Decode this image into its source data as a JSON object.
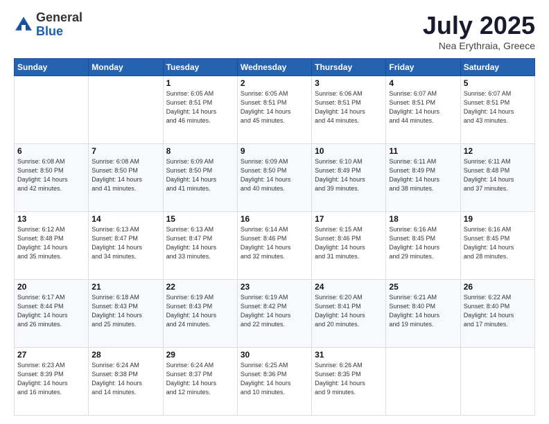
{
  "header": {
    "logo_general": "General",
    "logo_blue": "Blue",
    "month": "July 2025",
    "location": "Nea Erythraia, Greece"
  },
  "weekdays": [
    "Sunday",
    "Monday",
    "Tuesday",
    "Wednesday",
    "Thursday",
    "Friday",
    "Saturday"
  ],
  "weeks": [
    [
      {
        "day": "",
        "info": ""
      },
      {
        "day": "",
        "info": ""
      },
      {
        "day": "1",
        "info": "Sunrise: 6:05 AM\nSunset: 8:51 PM\nDaylight: 14 hours\nand 46 minutes."
      },
      {
        "day": "2",
        "info": "Sunrise: 6:05 AM\nSunset: 8:51 PM\nDaylight: 14 hours\nand 45 minutes."
      },
      {
        "day": "3",
        "info": "Sunrise: 6:06 AM\nSunset: 8:51 PM\nDaylight: 14 hours\nand 44 minutes."
      },
      {
        "day": "4",
        "info": "Sunrise: 6:07 AM\nSunset: 8:51 PM\nDaylight: 14 hours\nand 44 minutes."
      },
      {
        "day": "5",
        "info": "Sunrise: 6:07 AM\nSunset: 8:51 PM\nDaylight: 14 hours\nand 43 minutes."
      }
    ],
    [
      {
        "day": "6",
        "info": "Sunrise: 6:08 AM\nSunset: 8:50 PM\nDaylight: 14 hours\nand 42 minutes."
      },
      {
        "day": "7",
        "info": "Sunrise: 6:08 AM\nSunset: 8:50 PM\nDaylight: 14 hours\nand 41 minutes."
      },
      {
        "day": "8",
        "info": "Sunrise: 6:09 AM\nSunset: 8:50 PM\nDaylight: 14 hours\nand 41 minutes."
      },
      {
        "day": "9",
        "info": "Sunrise: 6:09 AM\nSunset: 8:50 PM\nDaylight: 14 hours\nand 40 minutes."
      },
      {
        "day": "10",
        "info": "Sunrise: 6:10 AM\nSunset: 8:49 PM\nDaylight: 14 hours\nand 39 minutes."
      },
      {
        "day": "11",
        "info": "Sunrise: 6:11 AM\nSunset: 8:49 PM\nDaylight: 14 hours\nand 38 minutes."
      },
      {
        "day": "12",
        "info": "Sunrise: 6:11 AM\nSunset: 8:48 PM\nDaylight: 14 hours\nand 37 minutes."
      }
    ],
    [
      {
        "day": "13",
        "info": "Sunrise: 6:12 AM\nSunset: 8:48 PM\nDaylight: 14 hours\nand 35 minutes."
      },
      {
        "day": "14",
        "info": "Sunrise: 6:13 AM\nSunset: 8:47 PM\nDaylight: 14 hours\nand 34 minutes."
      },
      {
        "day": "15",
        "info": "Sunrise: 6:13 AM\nSunset: 8:47 PM\nDaylight: 14 hours\nand 33 minutes."
      },
      {
        "day": "16",
        "info": "Sunrise: 6:14 AM\nSunset: 8:46 PM\nDaylight: 14 hours\nand 32 minutes."
      },
      {
        "day": "17",
        "info": "Sunrise: 6:15 AM\nSunset: 8:46 PM\nDaylight: 14 hours\nand 31 minutes."
      },
      {
        "day": "18",
        "info": "Sunrise: 6:16 AM\nSunset: 8:45 PM\nDaylight: 14 hours\nand 29 minutes."
      },
      {
        "day": "19",
        "info": "Sunrise: 6:16 AM\nSunset: 8:45 PM\nDaylight: 14 hours\nand 28 minutes."
      }
    ],
    [
      {
        "day": "20",
        "info": "Sunrise: 6:17 AM\nSunset: 8:44 PM\nDaylight: 14 hours\nand 26 minutes."
      },
      {
        "day": "21",
        "info": "Sunrise: 6:18 AM\nSunset: 8:43 PM\nDaylight: 14 hours\nand 25 minutes."
      },
      {
        "day": "22",
        "info": "Sunrise: 6:19 AM\nSunset: 8:43 PM\nDaylight: 14 hours\nand 24 minutes."
      },
      {
        "day": "23",
        "info": "Sunrise: 6:19 AM\nSunset: 8:42 PM\nDaylight: 14 hours\nand 22 minutes."
      },
      {
        "day": "24",
        "info": "Sunrise: 6:20 AM\nSunset: 8:41 PM\nDaylight: 14 hours\nand 20 minutes."
      },
      {
        "day": "25",
        "info": "Sunrise: 6:21 AM\nSunset: 8:40 PM\nDaylight: 14 hours\nand 19 minutes."
      },
      {
        "day": "26",
        "info": "Sunrise: 6:22 AM\nSunset: 8:40 PM\nDaylight: 14 hours\nand 17 minutes."
      }
    ],
    [
      {
        "day": "27",
        "info": "Sunrise: 6:23 AM\nSunset: 8:39 PM\nDaylight: 14 hours\nand 16 minutes."
      },
      {
        "day": "28",
        "info": "Sunrise: 6:24 AM\nSunset: 8:38 PM\nDaylight: 14 hours\nand 14 minutes."
      },
      {
        "day": "29",
        "info": "Sunrise: 6:24 AM\nSunset: 8:37 PM\nDaylight: 14 hours\nand 12 minutes."
      },
      {
        "day": "30",
        "info": "Sunrise: 6:25 AM\nSunset: 8:36 PM\nDaylight: 14 hours\nand 10 minutes."
      },
      {
        "day": "31",
        "info": "Sunrise: 6:26 AM\nSunset: 8:35 PM\nDaylight: 14 hours\nand 9 minutes."
      },
      {
        "day": "",
        "info": ""
      },
      {
        "day": "",
        "info": ""
      }
    ]
  ]
}
